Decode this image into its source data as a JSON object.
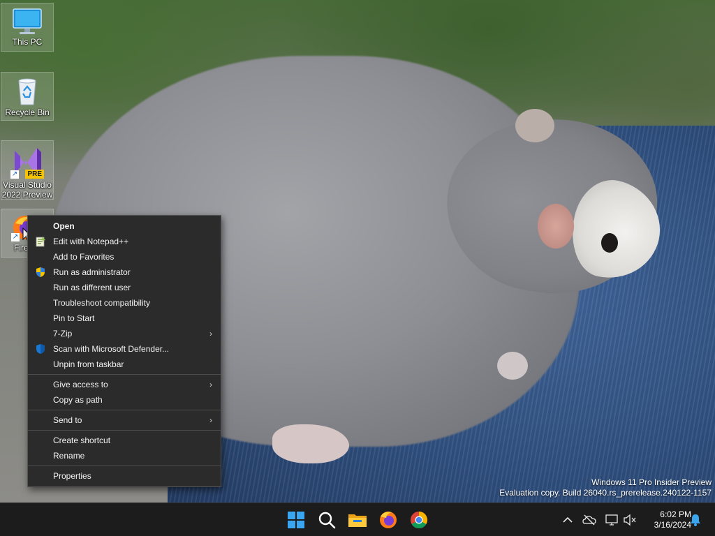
{
  "desktop_icons": [
    {
      "label": "This PC",
      "icon": "this-pc-icon"
    },
    {
      "label": "Recycle Bin",
      "icon": "recycle-bin-icon"
    },
    {
      "label_line1": "Visual Studio",
      "label_line2": "2022 Preview",
      "badge": "PRE",
      "icon": "visual-studio-preview-icon"
    },
    {
      "label": "Fire",
      "icon": "firefox-icon"
    }
  ],
  "context_menu": {
    "items": [
      {
        "label": "Open",
        "bold": true
      },
      {
        "label": "Edit with Notepad++",
        "icon": "notepad-plus-plus-icon"
      },
      {
        "label": "Add to Favorites"
      },
      {
        "label": "Run as administrator",
        "icon": "uac-shield-icon"
      },
      {
        "label": "Run as different user"
      },
      {
        "label": "Troubleshoot compatibility"
      },
      {
        "label": "Pin to Start"
      },
      {
        "label": "7-Zip",
        "submenu": true
      },
      {
        "label": "Scan with Microsoft Defender...",
        "icon": "defender-shield-icon"
      },
      {
        "label": "Unpin from taskbar"
      },
      {
        "label": "Give access to",
        "submenu": true
      },
      {
        "label": "Copy as path"
      },
      {
        "label": "Send to",
        "submenu": true
      },
      {
        "label": "Create shortcut"
      },
      {
        "label": "Rename"
      },
      {
        "label": "Properties"
      }
    ]
  },
  "watermark": {
    "line1": "Windows 11 Pro Insider Preview",
    "line2": "Evaluation copy. Build 26040.rs_prerelease.240122-1157"
  },
  "taskbar": {
    "pinned": [
      "start-icon",
      "search-icon",
      "file-explorer-icon",
      "firefox-icon",
      "chrome-icon"
    ],
    "tray": [
      "chevron-up-icon",
      "onedrive-icon",
      "network-icon",
      "volume-muted-icon",
      "notification-bell-icon"
    ],
    "clock_time": "6:02 PM",
    "clock_date": "3/16/2024"
  },
  "colors": {
    "menu_bg": "#2b2b2b",
    "taskbar_bg": "#1c1c1c",
    "accent_blue": "#0a84d8"
  }
}
